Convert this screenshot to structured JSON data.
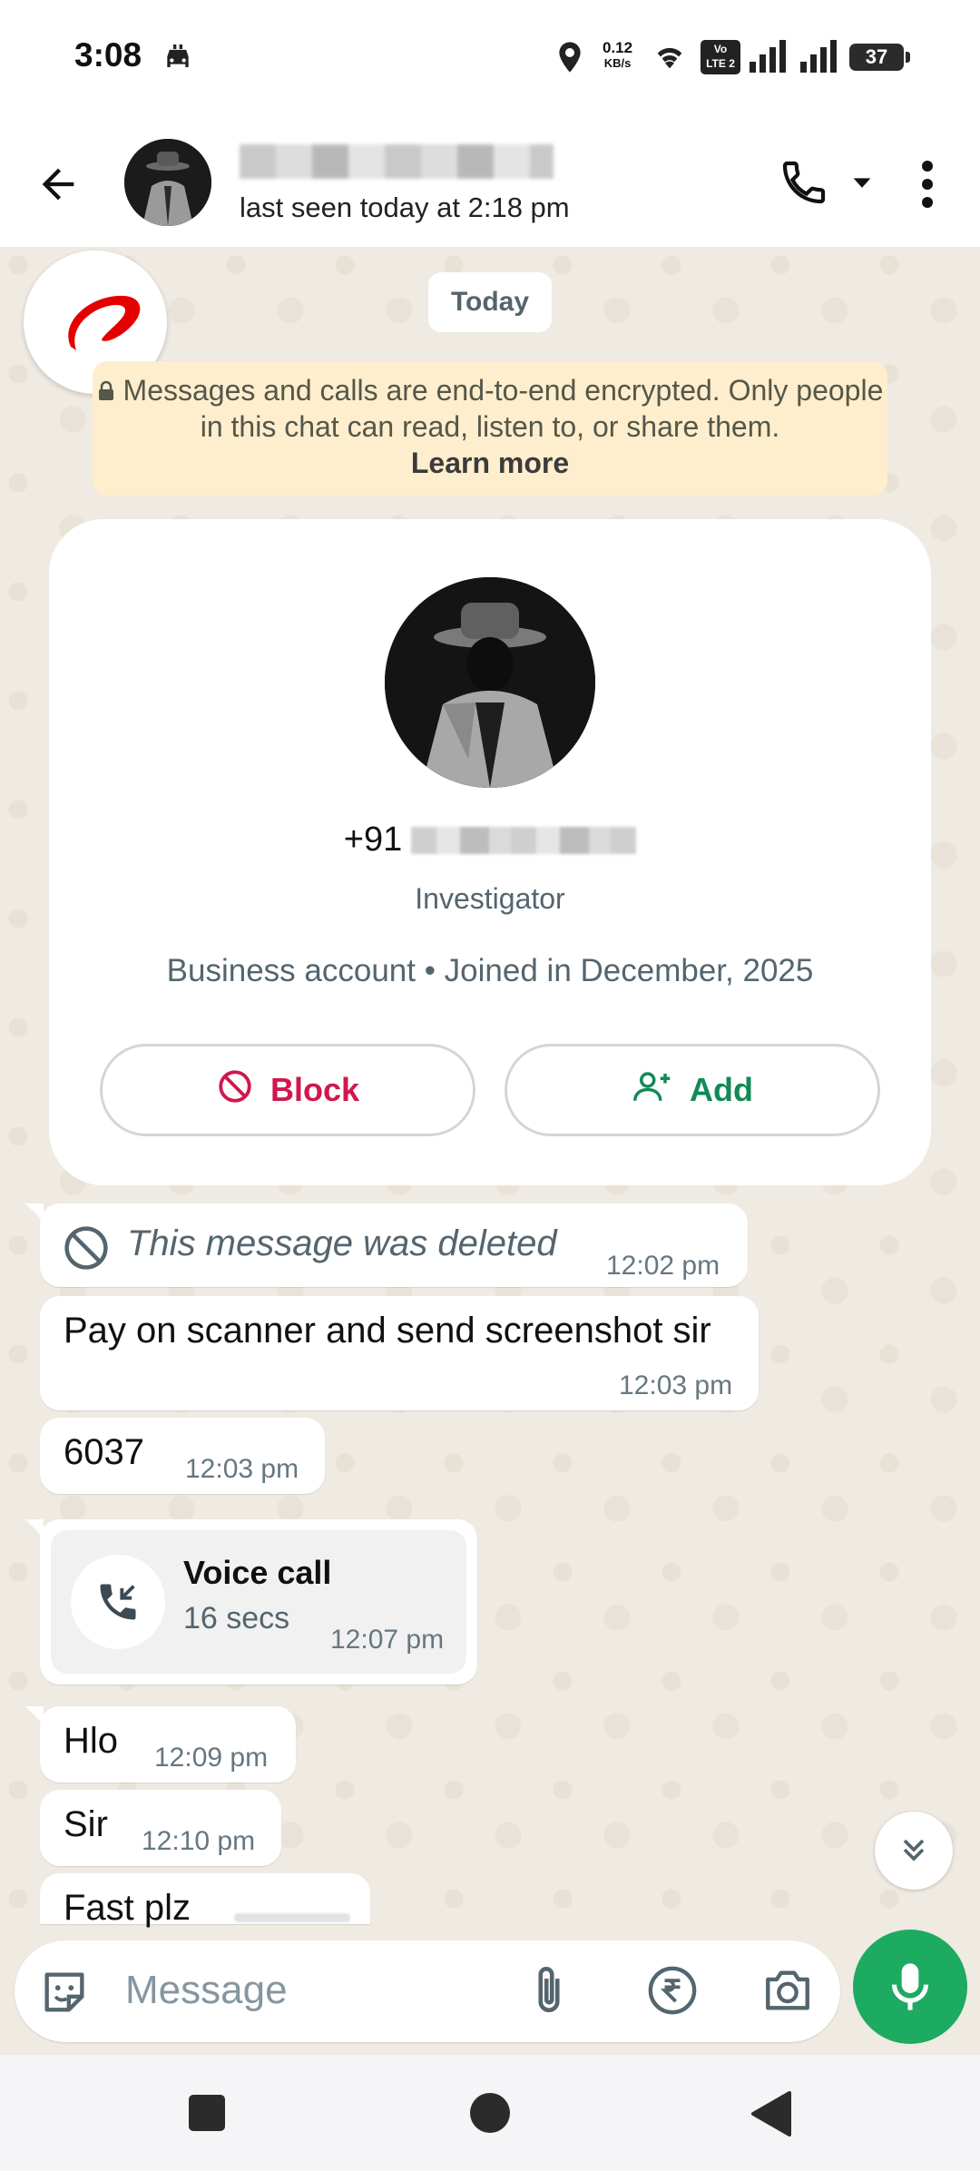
{
  "status_bar": {
    "time": "3:08",
    "net_speed_value": "0.12",
    "net_speed_unit": "KB/s",
    "lte_label_top": "Vo",
    "lte_label_bottom": "LTE 2",
    "battery": "37"
  },
  "header": {
    "last_seen": "last seen today at 2:18 pm"
  },
  "chat": {
    "date_chip": "Today",
    "encryption_notice": "Messages and calls are end-to-end encrypted. Only people in this chat can read, listen to, or share them.",
    "learn_more": "Learn more",
    "profile": {
      "phone_prefix": "+91",
      "title": "Investigator",
      "meta": "Business account • Joined in December, 2025",
      "block_label": "Block",
      "add_label": "Add"
    },
    "messages": [
      {
        "text": "This message was deleted",
        "time": "12:02 pm"
      },
      {
        "text": "Pay on scanner and send screenshot sir",
        "time": "12:03 pm"
      },
      {
        "text": "6037",
        "time": "12:03 pm"
      },
      {
        "text": "Voice call",
        "detail": "16 secs",
        "time": "12:07 pm"
      },
      {
        "text": "Hlo",
        "time": "12:09 pm"
      },
      {
        "text": "Sir",
        "time": "12:10 pm"
      },
      {
        "text": "Fast plz",
        "time": ""
      }
    ]
  },
  "input": {
    "placeholder": "Message"
  },
  "colors": {
    "accent_green": "#1daa61",
    "block_red": "#d1174d",
    "add_green": "#118a56",
    "chat_bg": "#efeae2",
    "notice_bg": "#ffeecd"
  }
}
